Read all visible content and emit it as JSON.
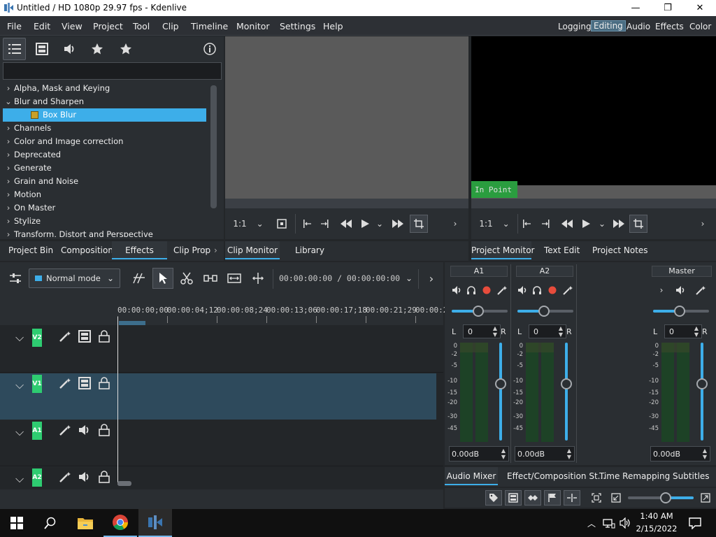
{
  "window": {
    "title": "Untitled / HD 1080p 29.97 fps - Kdenlive",
    "minimize": "—",
    "maximize": "❐",
    "close": "✕"
  },
  "menu": [
    "File",
    "Edit",
    "View",
    "Project",
    "Tool",
    "Clip",
    "Timeline",
    "Monitor",
    "Settings",
    "Help"
  ],
  "workspaces": [
    "Logging",
    "Editing",
    "Audio",
    "Effects",
    "Color"
  ],
  "workspace_active": "Editing",
  "effects": {
    "search_placeholder": "",
    "items": [
      {
        "label": "Alpha, Mask and Keying",
        "expanded": false
      },
      {
        "label": "Blur and Sharpen",
        "expanded": true
      },
      {
        "label": "Box Blur",
        "child": true,
        "selected": true
      },
      {
        "label": "Channels",
        "expanded": false
      },
      {
        "label": "Color and Image correction",
        "expanded": false
      },
      {
        "label": "Deprecated",
        "expanded": false
      },
      {
        "label": "Generate",
        "expanded": false
      },
      {
        "label": "Grain and Noise",
        "expanded": false
      },
      {
        "label": "Motion",
        "expanded": false
      },
      {
        "label": "On Master",
        "expanded": false
      },
      {
        "label": "Stylize",
        "expanded": false
      },
      {
        "label": "Transform, Distort and Perspective",
        "expanded": false
      }
    ]
  },
  "left_tabs": [
    "Project Bin",
    "Compositions",
    "Effects",
    "Clip Prop"
  ],
  "left_tab_active": "Effects",
  "mid_tabs": [
    "Clip Monitor",
    "Library"
  ],
  "mid_tab_active": "Clip Monitor",
  "right_tabs": [
    "Project Monitor",
    "Text Edit",
    "Project Notes"
  ],
  "right_tab_active": "Project Monitor",
  "clip_monitor": {
    "zoom": "1:1"
  },
  "project_monitor": {
    "zoom": "1:1",
    "overlay": "In Point"
  },
  "timeline": {
    "mode": "Normal mode",
    "timecode": "00:00:00:00 / 00:00:00:00",
    "ruler": [
      "00:00:00;00",
      "00:00:04;12",
      "00:00:08;24",
      "00:00:13;06",
      "00:00:17;18",
      "00:00:21;29",
      "00:00:2"
    ],
    "tracks": [
      {
        "name": "V2",
        "type": "video"
      },
      {
        "name": "V1",
        "type": "video",
        "selected": true
      },
      {
        "name": "A1",
        "type": "audio"
      },
      {
        "name": "A2",
        "type": "audio"
      }
    ]
  },
  "mixer": {
    "channels": [
      {
        "name": "A1",
        "balance": "0",
        "gain": "0.00dB",
        "L": "L",
        "R": "R"
      },
      {
        "name": "A2",
        "balance": "0",
        "gain": "0.00dB",
        "L": "L",
        "R": "R"
      },
      {
        "name": "Master",
        "balance": "0",
        "gain": "0.00dB",
        "L": "L",
        "R": "R"
      }
    ],
    "scale": [
      "0",
      "-2",
      "-5",
      "-10",
      "-15",
      "-20",
      "-30",
      "-45"
    ]
  },
  "bottom_tabs": [
    "Audio Mixer",
    "Effect/Composition St...",
    "Time Remapping",
    "Subtitles"
  ],
  "bottom_tab_active": "Audio Mixer",
  "taskbar": {
    "time": "1:40 AM",
    "date": "2/15/2022"
  },
  "colors": {
    "accent": "#3daee9",
    "track_label": "#2ecc71",
    "record": "#e74c3c"
  }
}
